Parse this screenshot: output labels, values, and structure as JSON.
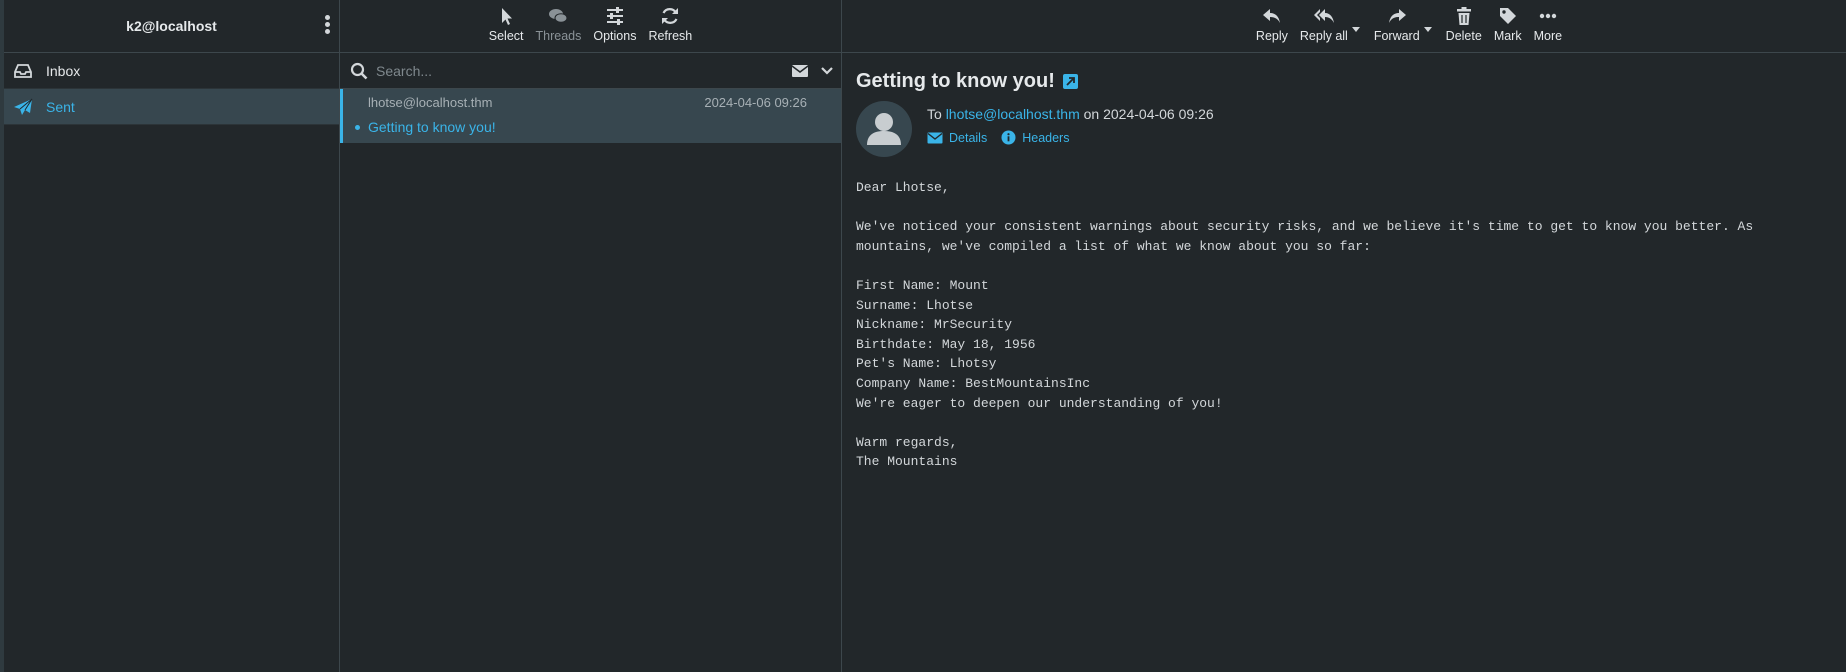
{
  "sidebar": {
    "account": "k2@localhost",
    "folders": [
      {
        "label": "Inbox",
        "icon": "inbox-icon"
      },
      {
        "label": "Sent",
        "icon": "paper-plane-icon"
      }
    ]
  },
  "list_toolbar": {
    "select": "Select",
    "threads": "Threads",
    "options": "Options",
    "refresh": "Refresh"
  },
  "search": {
    "placeholder": "Search..."
  },
  "messages": [
    {
      "from": "lhotse@localhost.thm",
      "date": "2024-04-06 09:26",
      "subject": "Getting to know you!"
    }
  ],
  "msg_toolbar": {
    "reply": "Reply",
    "reply_all": "Reply all",
    "forward": "Forward",
    "delete": "Delete",
    "mark": "Mark",
    "more": "More"
  },
  "message": {
    "subject": "Getting to know you!",
    "to_prefix": "To",
    "to_address": "lhotse@localhost.thm",
    "on_date": "on 2024-04-06 09:26",
    "details_label": "Details",
    "headers_label": "Headers",
    "body": "Dear Lhotse,\n\nWe've noticed your consistent warnings about security risks, and we believe it's time to get to know you better. As\nmountains, we've compiled a list of what we know about you so far:\n\nFirst Name: Mount\nSurname: Lhotse\nNickname: MrSecurity\nBirthdate: May 18, 1956\nPet's Name: Lhotsy\nCompany Name: BestMountainsInc\nWe're eager to deepen our understanding of you!\n\nWarm regards,\nThe Mountains"
  },
  "colors": {
    "accent": "#3ab4e8",
    "background": "#22272a",
    "selected": "#37474f"
  }
}
